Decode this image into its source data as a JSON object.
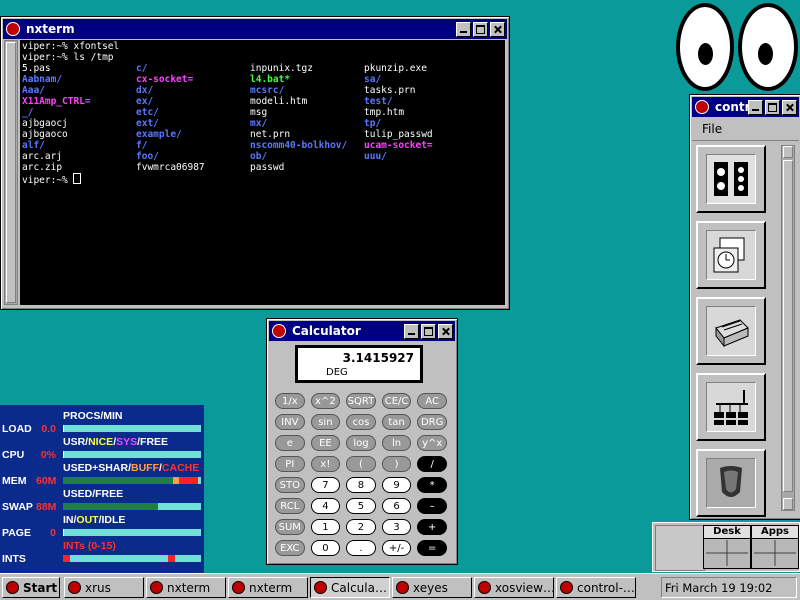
{
  "terminal": {
    "title": "nxterm",
    "lines": [
      [
        {
          "t": "viper:~% xfontsel",
          "c": ""
        }
      ],
      [
        {
          "t": "viper:~% ls /tmp",
          "c": ""
        }
      ],
      [
        {
          "t": "5.pas",
          "c": ""
        },
        {
          "t": "c/",
          "c": "dir"
        },
        {
          "t": "inpunix.tgz",
          "c": ""
        },
        {
          "t": "pkunzip.exe",
          "c": ""
        }
      ],
      [
        {
          "t": "Aabnam/",
          "c": "dir"
        },
        {
          "t": "cx-socket=",
          "c": "sock"
        },
        {
          "t": "l4.bat*",
          "c": "exe"
        },
        {
          "t": "sa/",
          "c": "dir"
        }
      ],
      [
        {
          "t": "Aaa/",
          "c": "dir"
        },
        {
          "t": "dx/",
          "c": "dir"
        },
        {
          "t": "mcsrc/",
          "c": "dir"
        },
        {
          "t": "tasks.prn",
          "c": ""
        }
      ],
      [
        {
          "t": "X11Amp_CTRL=",
          "c": "sock"
        },
        {
          "t": "ex/",
          "c": "dir"
        },
        {
          "t": "modeli.htm",
          "c": ""
        },
        {
          "t": "test/",
          "c": "dir"
        }
      ],
      [
        {
          "t": "_/",
          "c": "dir"
        },
        {
          "t": "etc/",
          "c": "dir"
        },
        {
          "t": "msg",
          "c": ""
        },
        {
          "t": "tmp.htm",
          "c": ""
        }
      ],
      [
        {
          "t": "ajbgaocj",
          "c": ""
        },
        {
          "t": "ext/",
          "c": "dir"
        },
        {
          "t": "mx/",
          "c": "dir"
        },
        {
          "t": "tp/",
          "c": "dir"
        }
      ],
      [
        {
          "t": "ajbgaoco",
          "c": ""
        },
        {
          "t": "example/",
          "c": "dir"
        },
        {
          "t": "net.prn",
          "c": ""
        },
        {
          "t": "tulip_passwd",
          "c": ""
        }
      ],
      [
        {
          "t": "alf/",
          "c": "dir"
        },
        {
          "t": "f/",
          "c": "dir"
        },
        {
          "t": "nscomm40-bolkhov/",
          "c": "dir"
        },
        {
          "t": "ucam-socket=",
          "c": "sock"
        }
      ],
      [
        {
          "t": "arc.arj",
          "c": ""
        },
        {
          "t": "foo/",
          "c": "dir"
        },
        {
          "t": "ob/",
          "c": "dir"
        },
        {
          "t": "uuu/",
          "c": "dir"
        }
      ],
      [
        {
          "t": "arc.zip",
          "c": ""
        },
        {
          "t": "fvwmrca06987",
          "c": ""
        },
        {
          "t": "passwd",
          "c": ""
        }
      ]
    ],
    "prompt": "viper:~% "
  },
  "control_panel": {
    "title": "control-panel",
    "title_visible": "contr",
    "menu_file": "File",
    "items": [
      "system-services-icon",
      "time-date-icon",
      "printer-icon",
      "network-config-icon",
      "kernel-daemon-icon"
    ]
  },
  "calculator": {
    "title": "Calculator",
    "display_value": "3.1415927",
    "display_mode": "DEG",
    "rows": [
      [
        {
          "k": "1/x",
          "s": "grey"
        },
        {
          "k": "x^2",
          "s": "grey"
        },
        {
          "k": "SQRT",
          "s": "grey"
        },
        {
          "k": "CE/C",
          "s": "grey"
        },
        {
          "k": "AC",
          "s": "grey"
        }
      ],
      [
        {
          "k": "INV",
          "s": "grey"
        },
        {
          "k": "sin",
          "s": "grey"
        },
        {
          "k": "cos",
          "s": "grey"
        },
        {
          "k": "tan",
          "s": "grey"
        },
        {
          "k": "DRG",
          "s": "grey"
        }
      ],
      [
        {
          "k": "e",
          "s": "grey"
        },
        {
          "k": "EE",
          "s": "grey"
        },
        {
          "k": "log",
          "s": "grey"
        },
        {
          "k": "ln",
          "s": "grey"
        },
        {
          "k": "y^x",
          "s": "grey"
        }
      ],
      [
        {
          "k": "PI",
          "s": "grey"
        },
        {
          "k": "x!",
          "s": "grey"
        },
        {
          "k": "(",
          "s": "grey"
        },
        {
          "k": ")",
          "s": "grey"
        },
        {
          "k": "/",
          "s": "black"
        }
      ],
      [
        {
          "k": "STO",
          "s": "grey"
        },
        {
          "k": "7",
          "s": "white"
        },
        {
          "k": "8",
          "s": "white"
        },
        {
          "k": "9",
          "s": "white"
        },
        {
          "k": "*",
          "s": "black"
        }
      ],
      [
        {
          "k": "RCL",
          "s": "grey"
        },
        {
          "k": "4",
          "s": "white"
        },
        {
          "k": "5",
          "s": "white"
        },
        {
          "k": "6",
          "s": "white"
        },
        {
          "k": "–",
          "s": "black"
        }
      ],
      [
        {
          "k": "SUM",
          "s": "grey"
        },
        {
          "k": "1",
          "s": "white"
        },
        {
          "k": "2",
          "s": "white"
        },
        {
          "k": "3",
          "s": "white"
        },
        {
          "k": "+",
          "s": "black"
        }
      ],
      [
        {
          "k": "EXC",
          "s": "grey"
        },
        {
          "k": "0",
          "s": "white"
        },
        {
          "k": ".",
          "s": "white"
        },
        {
          "k": "+/-",
          "s": "white"
        },
        {
          "k": "=",
          "s": "black"
        }
      ]
    ]
  },
  "xosview": {
    "rows": [
      {
        "label": "LOAD",
        "value": "0.0",
        "header": [
          {
            "t": "PROCS/MIN",
            "c": "#ffffff"
          }
        ],
        "bar": [
          {
            "f": 0.01,
            "c": "#ffffff"
          }
        ]
      },
      {
        "label": "CPU",
        "value": "0%",
        "header": [
          {
            "t": "USR",
            "c": "#ffffff"
          },
          {
            "t": "/",
            "c": "#ffffff"
          },
          {
            "t": "NICE",
            "c": "#ffff40"
          },
          {
            "t": "/",
            "c": "#ffffff"
          },
          {
            "t": "SYS",
            "c": "#ff40ff"
          },
          {
            "t": "/FREE",
            "c": "#ffffff"
          }
        ],
        "bar": [
          {
            "f": 0.01,
            "c": "#ffffff"
          }
        ]
      },
      {
        "label": "MEM",
        "value": "60M",
        "header": [
          {
            "t": "USED+SHAR",
            "c": "#ffffff"
          },
          {
            "t": "/",
            "c": "#ffffff"
          },
          {
            "t": "BUFF",
            "c": "#ffa040"
          },
          {
            "t": "/",
            "c": "#ffffff"
          },
          {
            "t": "CACHE",
            "c": "#ff3030"
          }
        ],
        "bar": [
          {
            "f": 0.8,
            "c": "#208040"
          },
          {
            "f": 0.04,
            "c": "#ffa040"
          },
          {
            "f": 0.14,
            "c": "#ff2020"
          }
        ]
      },
      {
        "label": "SWAP",
        "value": "88M",
        "header": [
          {
            "t": "USED",
            "c": "#ffffff"
          },
          {
            "t": "/FREE",
            "c": "#ffffff"
          }
        ],
        "bar": [
          {
            "f": 0.69,
            "c": "#208040"
          }
        ]
      },
      {
        "label": "PAGE",
        "value": "0",
        "header": [
          {
            "t": "IN",
            "c": "#ffffff"
          },
          {
            "t": "/",
            "c": "#ffffff"
          },
          {
            "t": "OUT",
            "c": "#ffff40"
          },
          {
            "t": "/IDLE",
            "c": "#ffffff"
          }
        ],
        "bar": [
          {
            "f": 0.0,
            "c": "#ffffff"
          }
        ]
      },
      {
        "label": "INTS",
        "value": "",
        "header": [
          {
            "t": "INTs (0-15)",
            "c": "#ff3030"
          }
        ],
        "bar": [
          {
            "f": 0.05,
            "c": "#ff2020",
            "o": 0.0
          },
          {
            "f": 0.05,
            "c": "#ff2020",
            "o": 0.76
          }
        ]
      }
    ]
  },
  "pager": {
    "desk_label": "Desk",
    "apps_label": "Apps"
  },
  "taskbar": {
    "start_label": "Start",
    "tasks": [
      {
        "label": "xrus",
        "active": false
      },
      {
        "label": "nxterm",
        "active": false
      },
      {
        "label": "nxterm",
        "active": false
      },
      {
        "label": "Calcula…",
        "active": true
      },
      {
        "label": "xeyes",
        "active": false
      },
      {
        "label": "xosview…",
        "active": false
      },
      {
        "label": "control-…",
        "active": false
      }
    ],
    "clock": "Fri March 19 19:02"
  }
}
